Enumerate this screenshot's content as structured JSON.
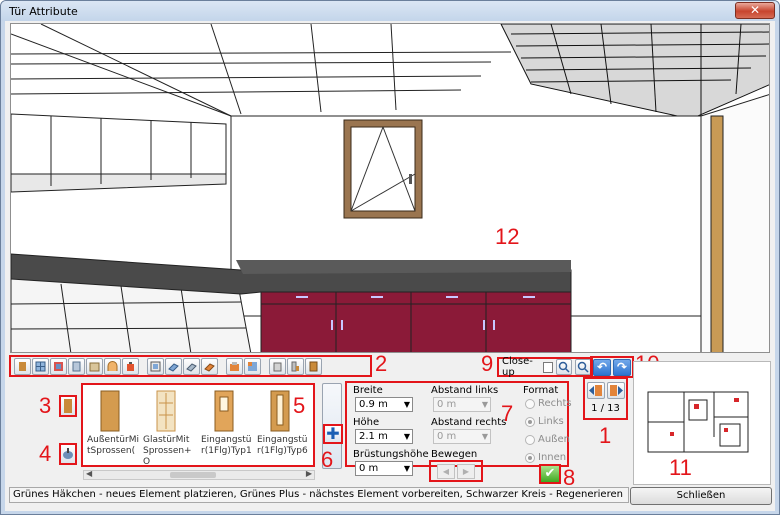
{
  "window": {
    "title": "Tür Attribute",
    "close_glyph": "✕"
  },
  "callouts": [
    "1",
    "2",
    "3",
    "4",
    "5",
    "6",
    "7",
    "8",
    "9",
    "10",
    "11",
    "12"
  ],
  "toolbar": {
    "icons": [
      "door-icon",
      "window-icon",
      "frame-icon",
      "panel-icon",
      "niche-icon",
      "arch-icon",
      "light-icon",
      "picture-icon",
      "shelf-icon",
      "beam-icon",
      "stair-icon",
      "wall-icon",
      "grid-icon",
      "sofa-icon",
      "chair-icon",
      "cabinet-icon"
    ]
  },
  "closeup": {
    "label": "Close-up",
    "checked": false
  },
  "elements": {
    "items": [
      {
        "label": "AußentürMitSprossen("
      },
      {
        "label": "GlastürMitSprossen+O"
      },
      {
        "label": "Eingangstür(1Flg)Typ1"
      },
      {
        "label": "Eingangstür(1Flg)Typ6"
      }
    ]
  },
  "plus_glyph": "✚",
  "attributes": {
    "breite_label": "Breite",
    "breite_value": "0.9 m",
    "hoehe_label": "Höhe",
    "hoehe_value": "2.1 m",
    "bruestung_label": "Brüstungshöhe",
    "bruestung_value": "0 m",
    "abstand_links_label": "Abstand links",
    "abstand_links_value": "0 m",
    "abstand_rechts_label": "Abstand rechts",
    "abstand_rechts_value": "0 m",
    "bewegen_label": "Bewegen",
    "format_label": "Format",
    "format_options": [
      "Rechts",
      "Links",
      "Außen",
      "Innen"
    ],
    "format_selected": [
      "Links",
      "Innen"
    ]
  },
  "ok_glyph": "✔",
  "navigation": {
    "count": "1 / 13"
  },
  "undo_glyph": "↶",
  "redo_glyph": "↷",
  "status_text": "Grünes Häkchen - neues Element platzieren, Grünes Plus - nächstes Element vorbereiten, Schwarzer Kreis - Regenerieren",
  "close_button_label": "Schließen",
  "colors": {
    "callout": "#e3151a",
    "cabinet": "#8b1a38",
    "counter": "#4a4a4a"
  }
}
